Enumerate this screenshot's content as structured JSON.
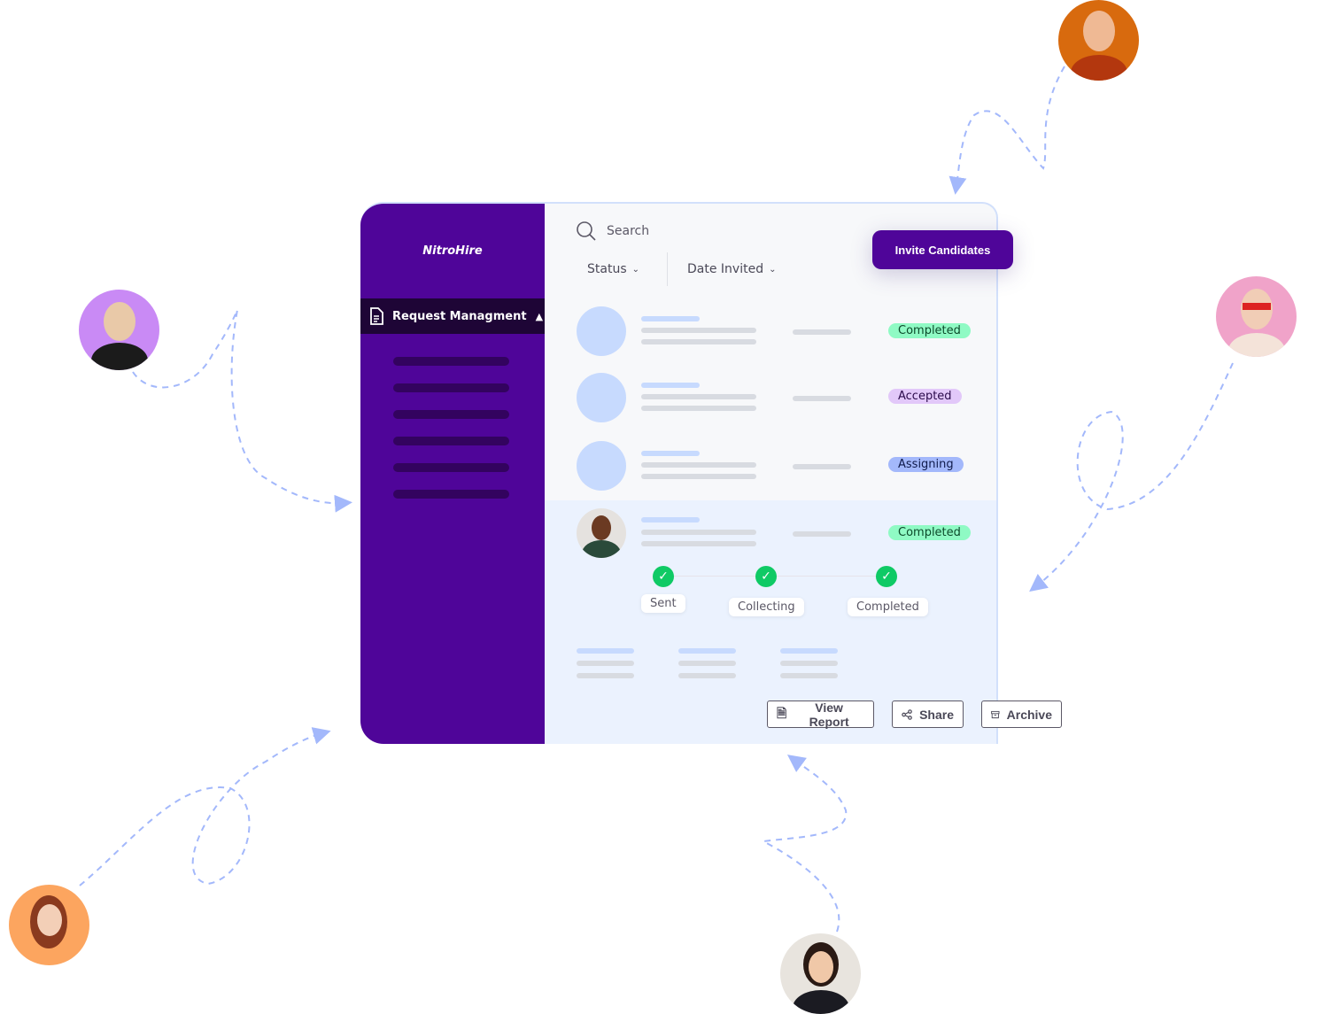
{
  "app": {
    "logo": "NitroHire"
  },
  "sidebar": {
    "active_item": "Request Managment"
  },
  "search": {
    "placeholder": "Search"
  },
  "filters": [
    {
      "label": "Status"
    },
    {
      "label": "Date Invited"
    }
  ],
  "invite_button": "Invite Candidates",
  "rows": [
    {
      "status": "Completed",
      "color": "#8ffac4"
    },
    {
      "status": "Accepted",
      "color": "#e2c8f9"
    },
    {
      "status": "Assigning",
      "color": "#a3b8fb"
    },
    {
      "status": "Completed",
      "color": "#8ffac4"
    }
  ],
  "steps": [
    "Sent",
    "Collecting",
    "Completed"
  ],
  "actions": {
    "view_report": "View Report",
    "share": "Share",
    "archive": "Archive"
  },
  "colors": {
    "brand": "#4f0599",
    "accent_line": "#a3b8fb",
    "success": "#0fca65"
  }
}
